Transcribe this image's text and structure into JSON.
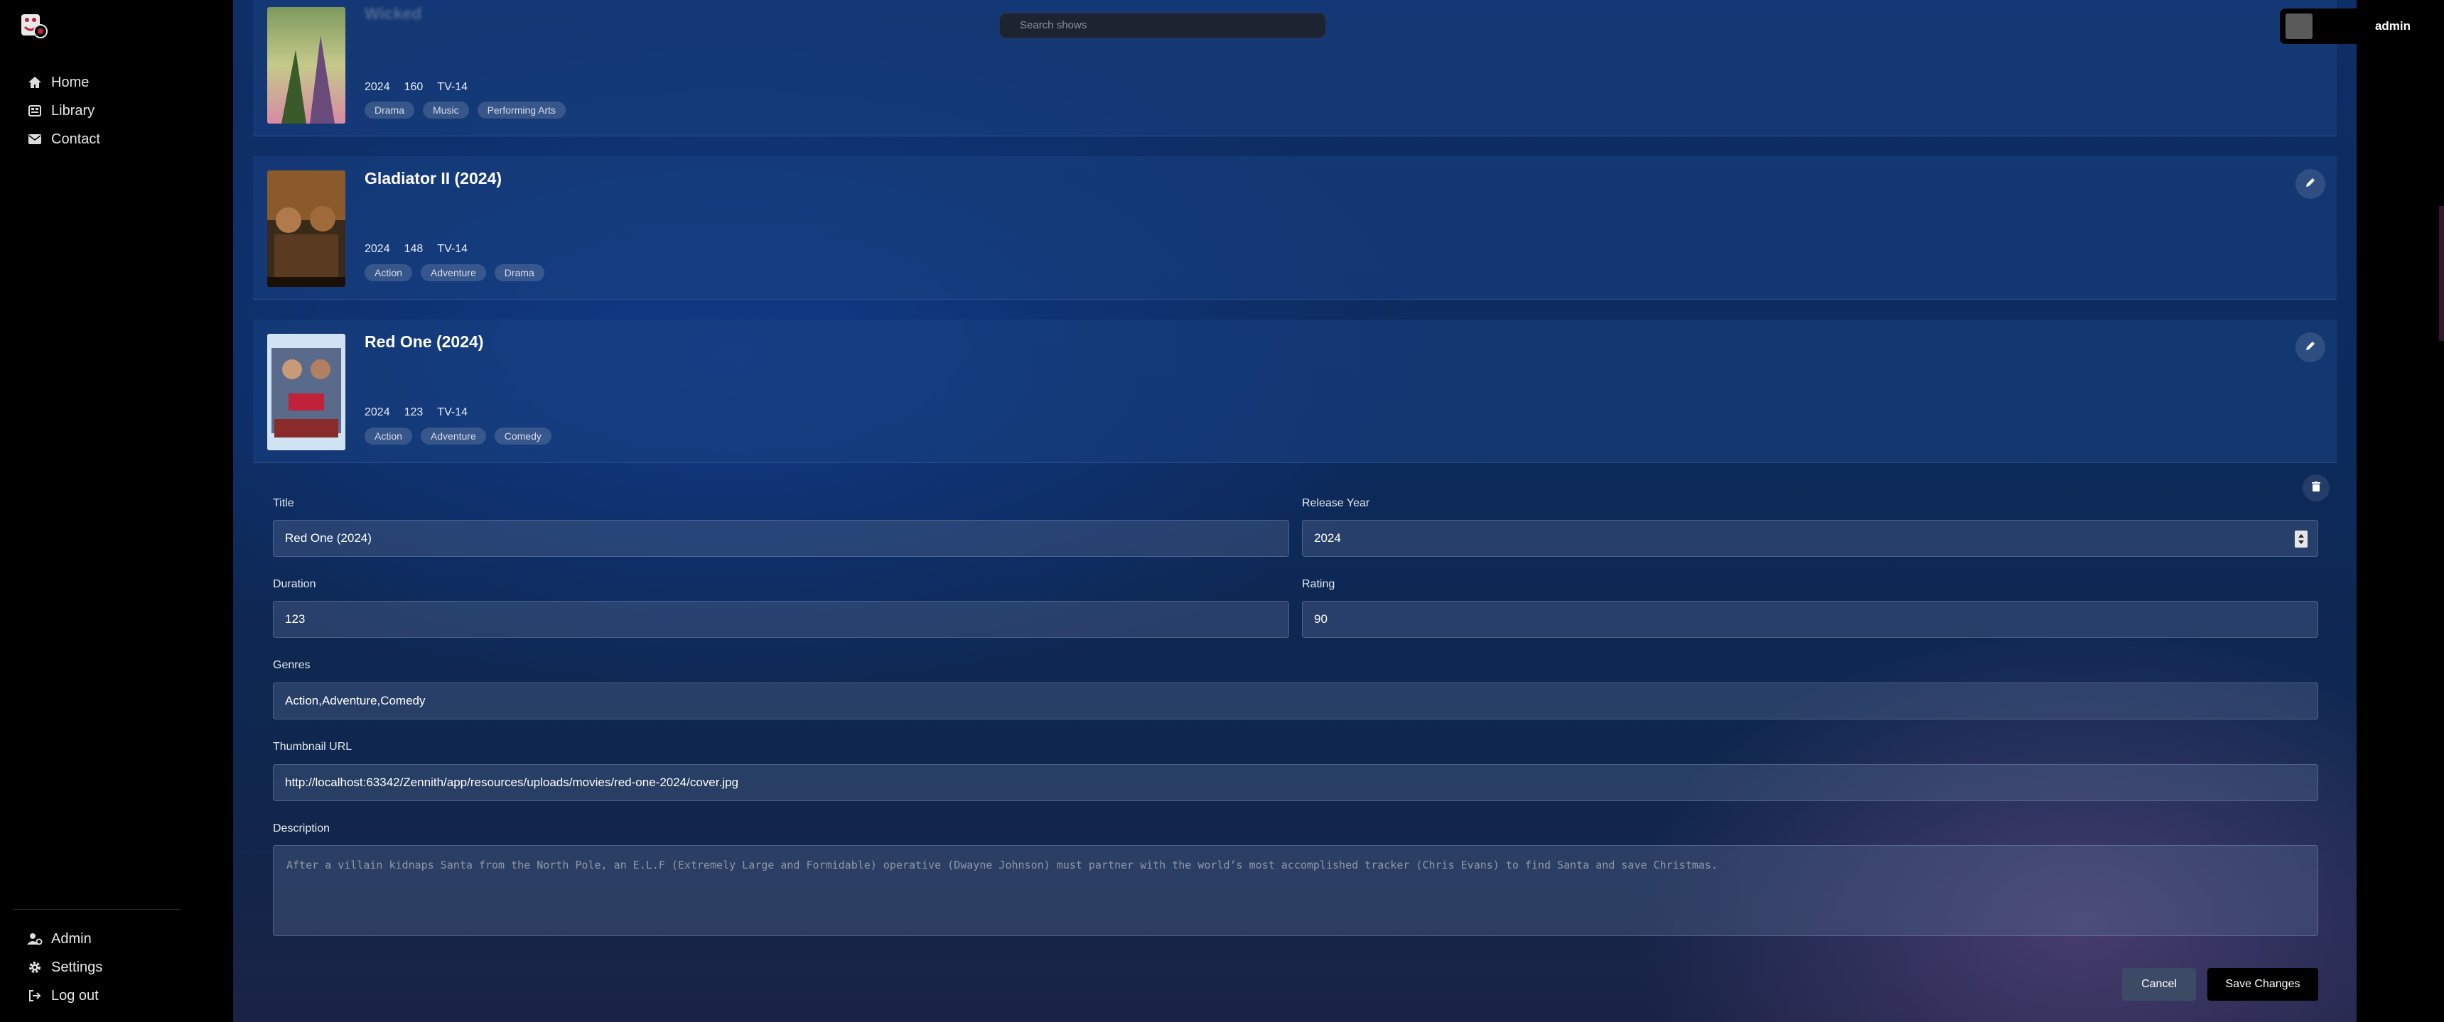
{
  "sidebar": {
    "logo_icon": "app-logo-icon",
    "nav": [
      {
        "label": "Home",
        "icon": "home-icon"
      },
      {
        "label": "Library",
        "icon": "library-icon"
      },
      {
        "label": "Contact",
        "icon": "mail-icon"
      }
    ],
    "bottom": [
      {
        "label": "Admin",
        "icon": "user-gear-icon"
      },
      {
        "label": "Settings",
        "icon": "gear-icon"
      },
      {
        "label": "Log out",
        "icon": "logout-icon"
      }
    ]
  },
  "header": {
    "search_placeholder": "Search shows",
    "user_name": "admin"
  },
  "cards": [
    {
      "title": "Wicked",
      "year": "2024",
      "duration": "160",
      "rating": "TV-14",
      "tags": [
        "Drama",
        "Music",
        "Performing Arts"
      ]
    },
    {
      "title": "Gladiator II (2024)",
      "year": "2024",
      "duration": "148",
      "rating": "TV-14",
      "tags": [
        "Action",
        "Adventure",
        "Drama"
      ]
    },
    {
      "title": "Red One (2024)",
      "year": "2024",
      "duration": "123",
      "rating": "TV-14",
      "tags": [
        "Action",
        "Adventure",
        "Comedy"
      ]
    }
  ],
  "form": {
    "title_label": "Title",
    "title_value": "Red One (2024)",
    "year_label": "Release Year",
    "year_value": "2024",
    "duration_label": "Duration",
    "duration_value": "123",
    "rating_label": "Rating",
    "rating_value": "90",
    "genres_label": "Genres",
    "genres_value": "Action,Adventure,Comedy",
    "thumb_label": "Thumbnail URL",
    "thumb_value": "http://localhost:63342/Zennith/app/resources/uploads/movies/red-one-2024/cover.jpg",
    "desc_label": "Description",
    "desc_value": "After a villain kidnaps Santa from the North Pole, an E.L.F (Extremely Large and Formidable) operative (Dwayne Johnson) must partner with the world’s most accomplished tracker (Chris Evans) to find Santa and save Christmas.",
    "cancel_label": "Cancel",
    "save_label": "Save Changes"
  }
}
